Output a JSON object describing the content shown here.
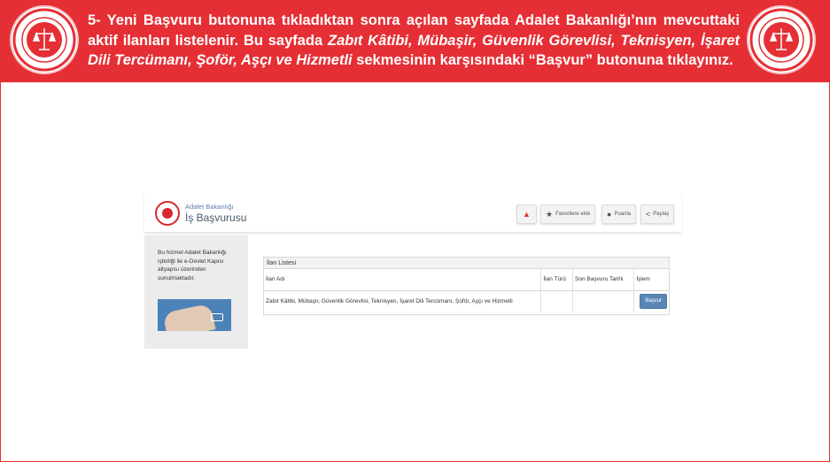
{
  "banner": {
    "step_text": "5- Yeni Başvuru butonuna tıkladıktan sonra açılan sayfada Adalet Bakanlığı’nın mevcuttaki aktif ilanları listelenir. Bu sayfada ",
    "italic_text": "Zabıt Kâtibi, Mübaşir, Güvenlik Görevlisi, Teknisyen, İşaret Dili Tercümanı, Şoför, Aşçı ve Hizmetli",
    "end_text": " sekmesinin karşısındaki “Başvur” butonuna tıklayınız.",
    "accent_color": "#e52f35"
  },
  "app": {
    "brand_small": "Adalet Bakanlığı",
    "brand_big": "İş Başvurusu",
    "header_buttons": [
      {
        "icon": "fire-icon",
        "label": ""
      },
      {
        "icon": "star-icon",
        "label": "Favorilere ekle"
      },
      {
        "icon": "comment-icon",
        "label": "Puanla"
      },
      {
        "icon": "share-icon",
        "label": "Paylaş"
      }
    ],
    "sidebar_text": "Bu hizmet Adalet Bakanlığı işbirliği ile e-Devlet Kapısı altyapısı üzerinden sunulmaktadır.",
    "panel_title": "İlan Listesi",
    "columns": [
      "İlan Adı",
      "İlan Türü",
      "Son Başvuru Tarihi",
      "İşlem"
    ],
    "rows": [
      {
        "name": "Zabıt Kâtibi, Mübaşir, Güvenlik Görevlisi, Teknisyen, İşaret Dili Tercümanı, Şoför, Aşçı ve Hizmetli",
        "type": "",
        "deadline": "",
        "action_label": "Başvur"
      }
    ]
  }
}
